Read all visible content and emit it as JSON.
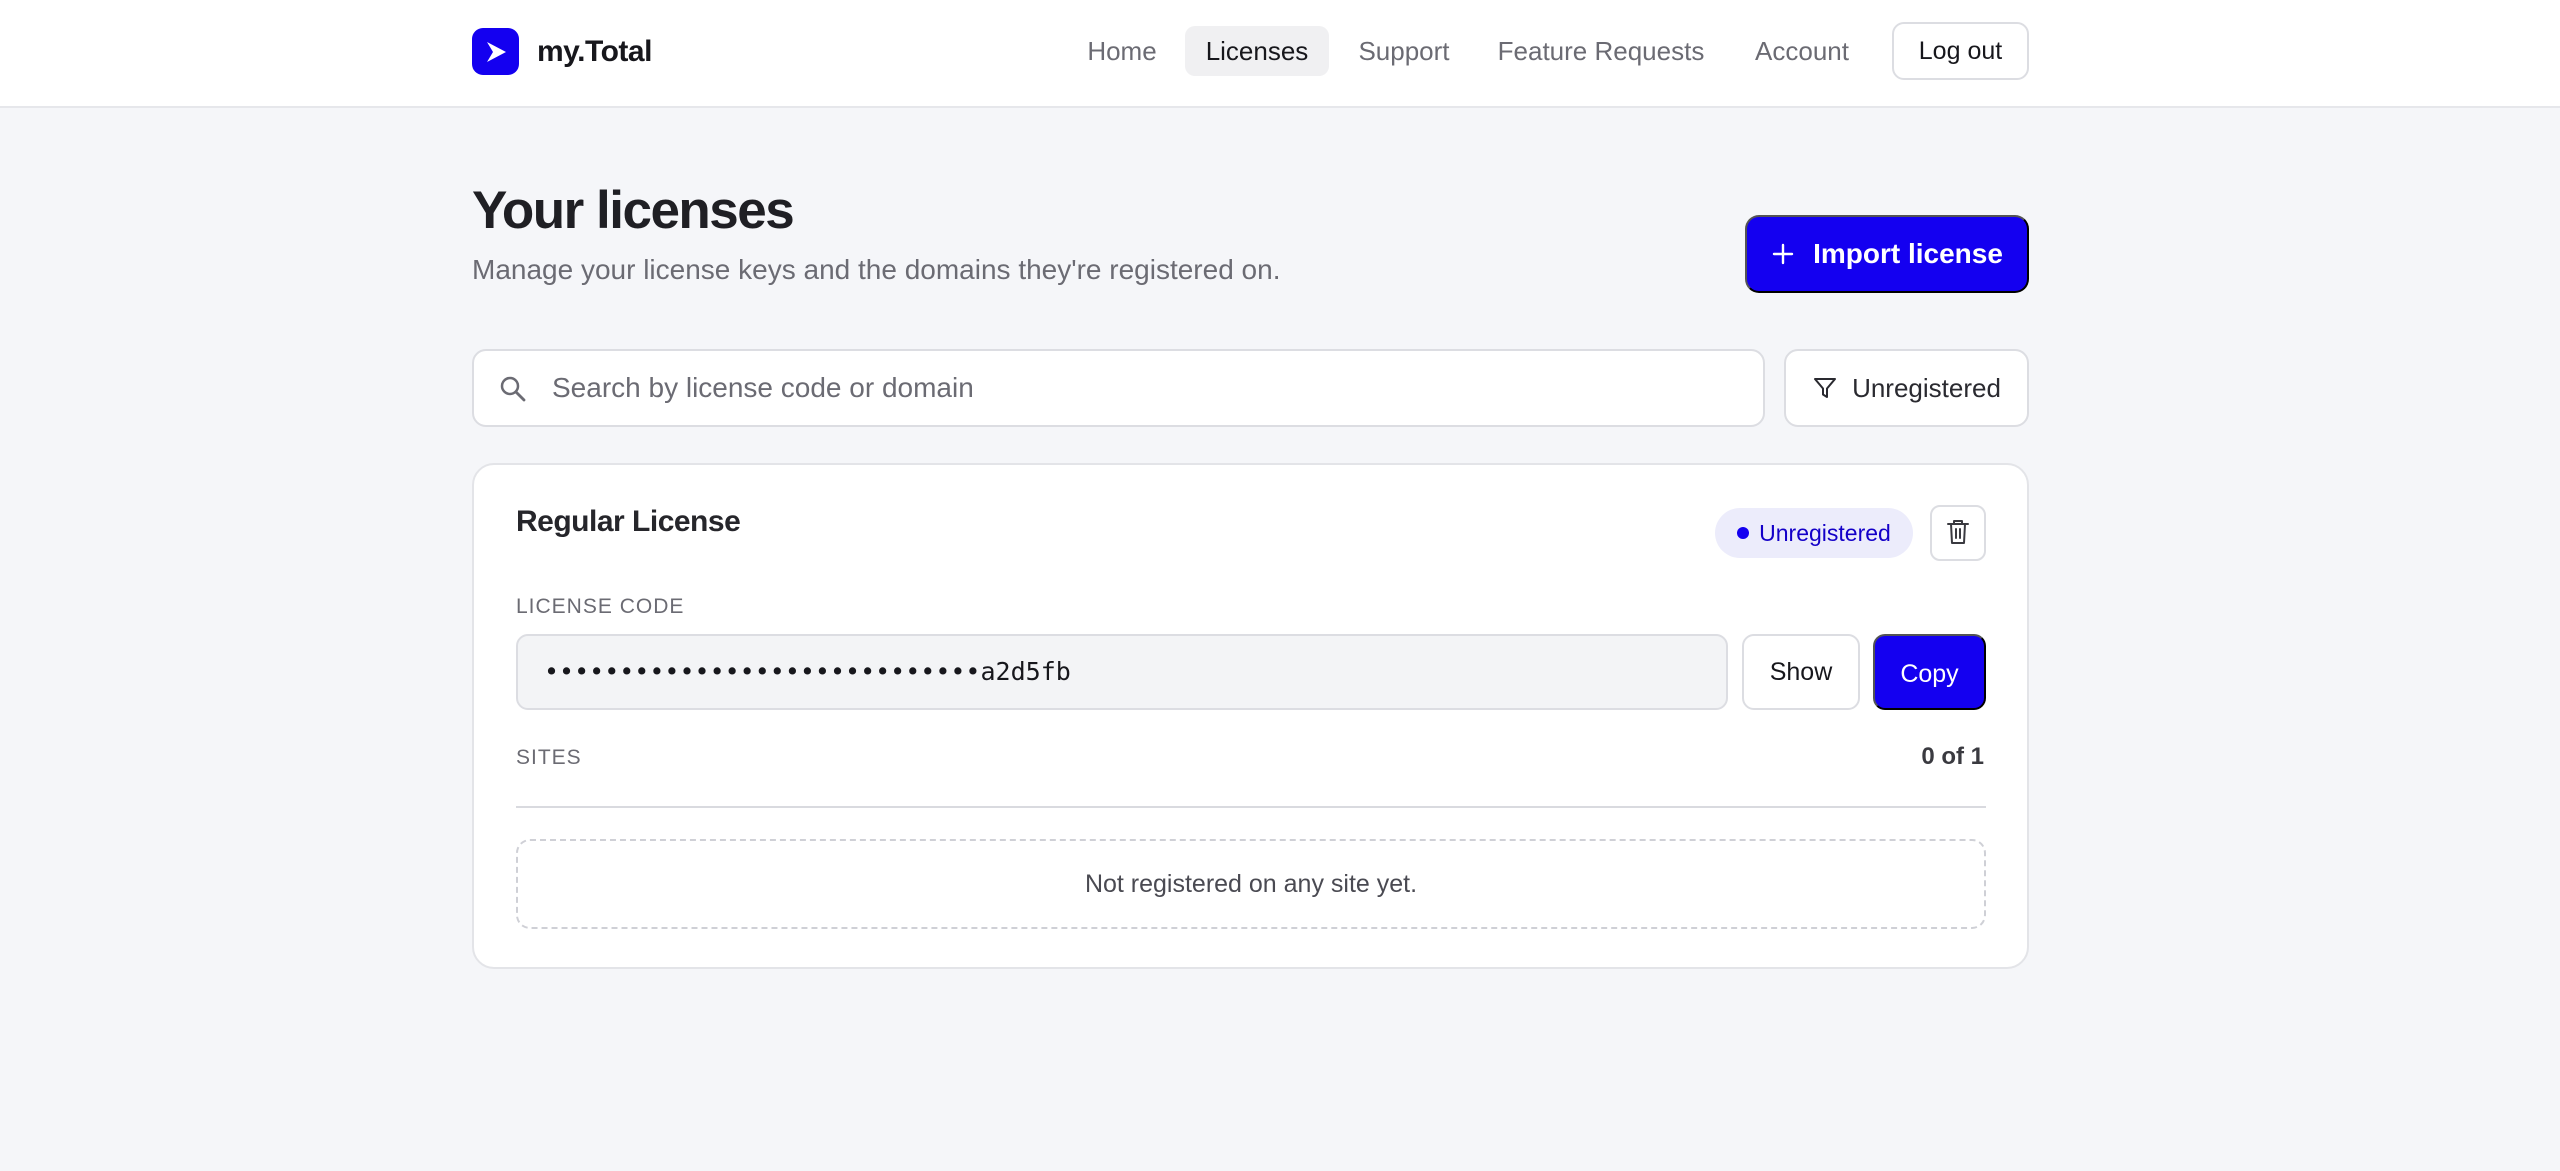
{
  "brand": {
    "name": "my.Total"
  },
  "nav": {
    "items": [
      {
        "label": "Home"
      },
      {
        "label": "Licenses",
        "active": true
      },
      {
        "label": "Support"
      },
      {
        "label": "Feature Requests"
      },
      {
        "label": "Account"
      }
    ],
    "logout_label": "Log out"
  },
  "header": {
    "title": "Your licenses",
    "subtitle": "Manage your license keys and the domains they're registered on.",
    "import_label": "Import license"
  },
  "search": {
    "placeholder": "Search by license code or domain",
    "value": "",
    "filter_label": "Unregistered"
  },
  "licenses": [
    {
      "title": "Regular License",
      "status": "Unregistered",
      "code_label": "LICENSE CODE",
      "code_masked": "•••••••••••••••••••••••••••••a2d5fb",
      "show_label": "Show",
      "copy_label": "Copy",
      "sites_label": "SITES",
      "sites_count": "0 of 1",
      "empty_sites": "Not registered on any site yet."
    }
  ],
  "icons": {
    "brand": "logo-play-icon",
    "import": "plus-icon",
    "search": "search-icon",
    "filter": "filter-funnel-icon",
    "delete": "trash-icon"
  },
  "colors": {
    "accent": "#1400f0",
    "background": "#f5f6f9",
    "badge_bg": "#ececfb"
  }
}
